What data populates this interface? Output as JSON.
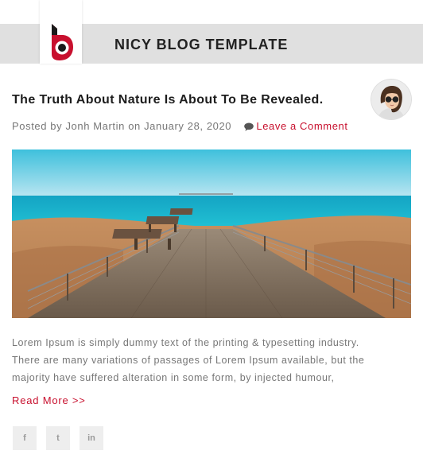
{
  "header": {
    "site_title": "NICY BLOG TEMPLATE",
    "logo_icon": "nicy-logo-icon",
    "background_color": "#e0e0e0"
  },
  "post": {
    "title": "The Truth About Nature Is About To Be Revealed.",
    "meta": {
      "prefix": "Posted by",
      "author": "Jonh Martin",
      "date_prefix": "on",
      "date": "January 28, 2020",
      "comment_icon": "comment-icon",
      "comment_link": "Leave a Comment"
    },
    "image_icon": "boardwalk-beach-image",
    "excerpt_lines": [
      "Lorem Ipsum is simply dummy text of the printing & typesetting industry.",
      "There are many variations of passages of Lorem Ipsum available, but the",
      "majority have suffered alteration in some form, by injected humour,"
    ],
    "read_more": "Read More >>"
  },
  "social": [
    {
      "name": "facebook",
      "glyph": "f"
    },
    {
      "name": "twitter",
      "glyph": "t"
    },
    {
      "name": "linkedin",
      "glyph": "in"
    }
  ],
  "colors": {
    "accent": "#c8102e",
    "title": "#1d1d1d",
    "meta_text": "#777777",
    "social_bg": "#eeeeee"
  }
}
